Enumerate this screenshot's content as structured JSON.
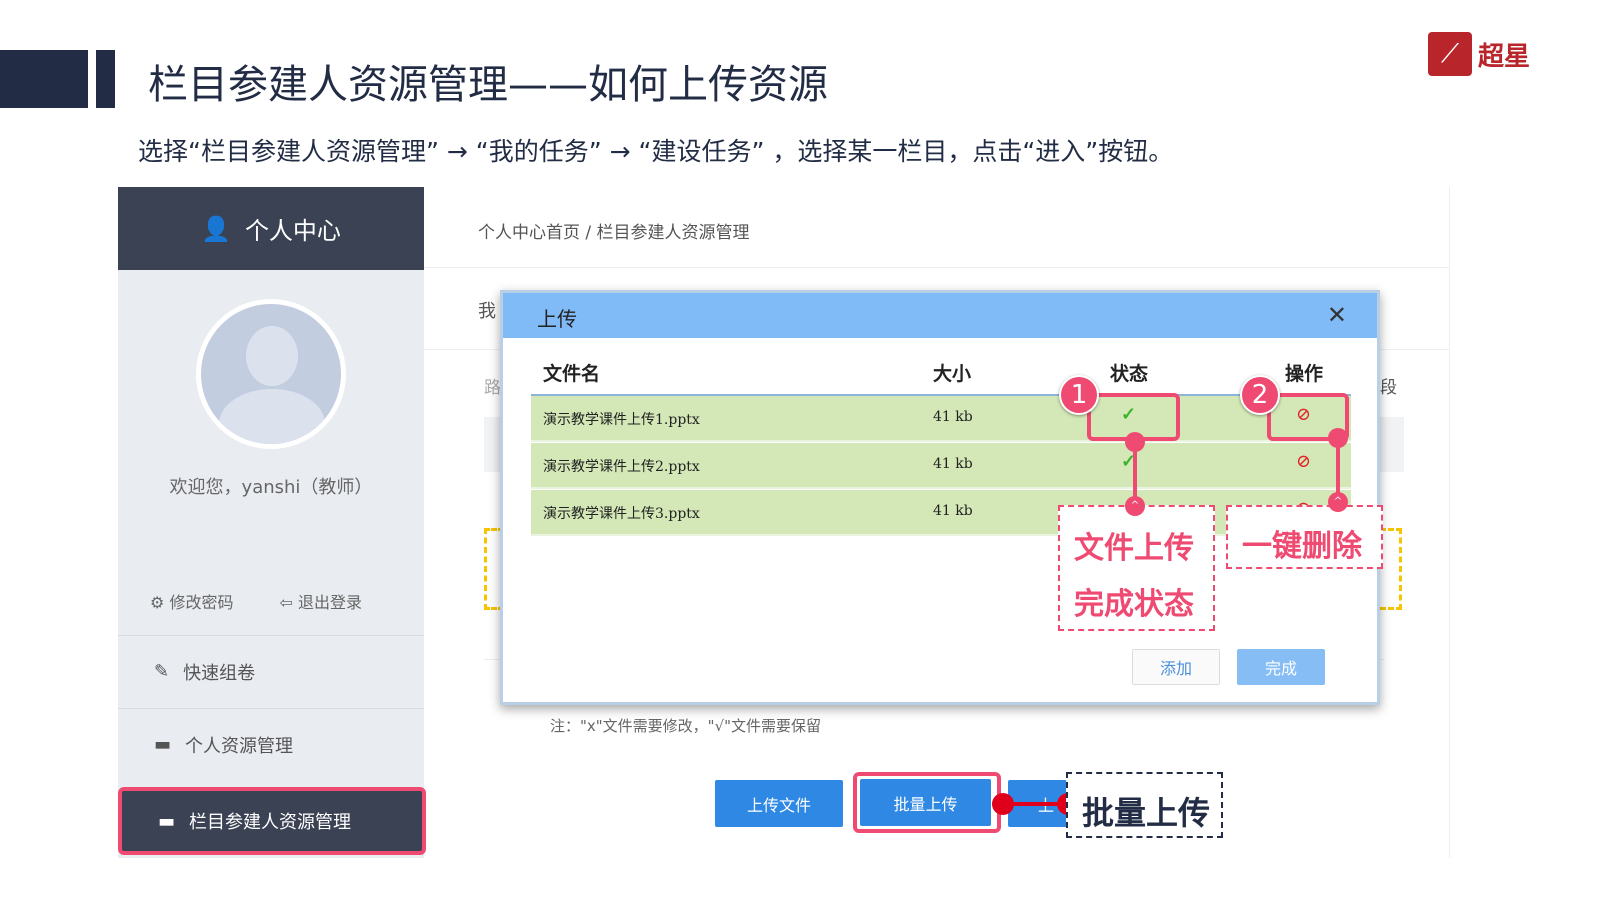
{
  "slide": {
    "title": "栏目参建人资源管理——如何上传资源",
    "subtitle": "选择“栏目参建人资源管理” → “我的任务” → “建设任务” ，选择某一栏目，点击“进入”按钮。",
    "logo_text": "超星"
  },
  "sidebar": {
    "header": "个人中心",
    "welcome": "欢迎您，yanshi（教师）",
    "change_password": "修改密码",
    "logout": "退出登录",
    "items": [
      {
        "label": "快速组卷"
      },
      {
        "label": "个人资源管理"
      },
      {
        "label": "栏目参建人资源管理"
      }
    ]
  },
  "main": {
    "breadcrumb": "个人中心首页 / 栏目参建人资源管理",
    "partial_tab": "我",
    "partial_path": "路",
    "partial_right": "段",
    "note": "注：\"x\"文件需要修改，\"√\"文件需要保留",
    "buttons": {
      "upload_file": "上传文件",
      "batch_upload": "批量上传",
      "third": "上"
    }
  },
  "modal": {
    "title": "上传",
    "close": "✕",
    "columns": [
      "文件名",
      "大小",
      "状态",
      "操作"
    ],
    "rows": [
      {
        "name": "演示教学课件上传1.pptx",
        "size": "41 kb",
        "status": "✓",
        "action": "⊘"
      },
      {
        "name": "演示教学课件上传2.pptx",
        "size": "41 kb",
        "status": "✓",
        "action": "⊘"
      },
      {
        "name": "演示教学课件上传3.pptx",
        "size": "41 kb",
        "status": "✓",
        "action": "⊘"
      }
    ],
    "add": "添加",
    "done": "完成"
  },
  "annotations": {
    "badge1": "1",
    "badge2": "2",
    "callout1_line1": "文件上传",
    "callout1_line2": "完成状态",
    "callout2": "一键删除",
    "callout3": "批量上传"
  }
}
